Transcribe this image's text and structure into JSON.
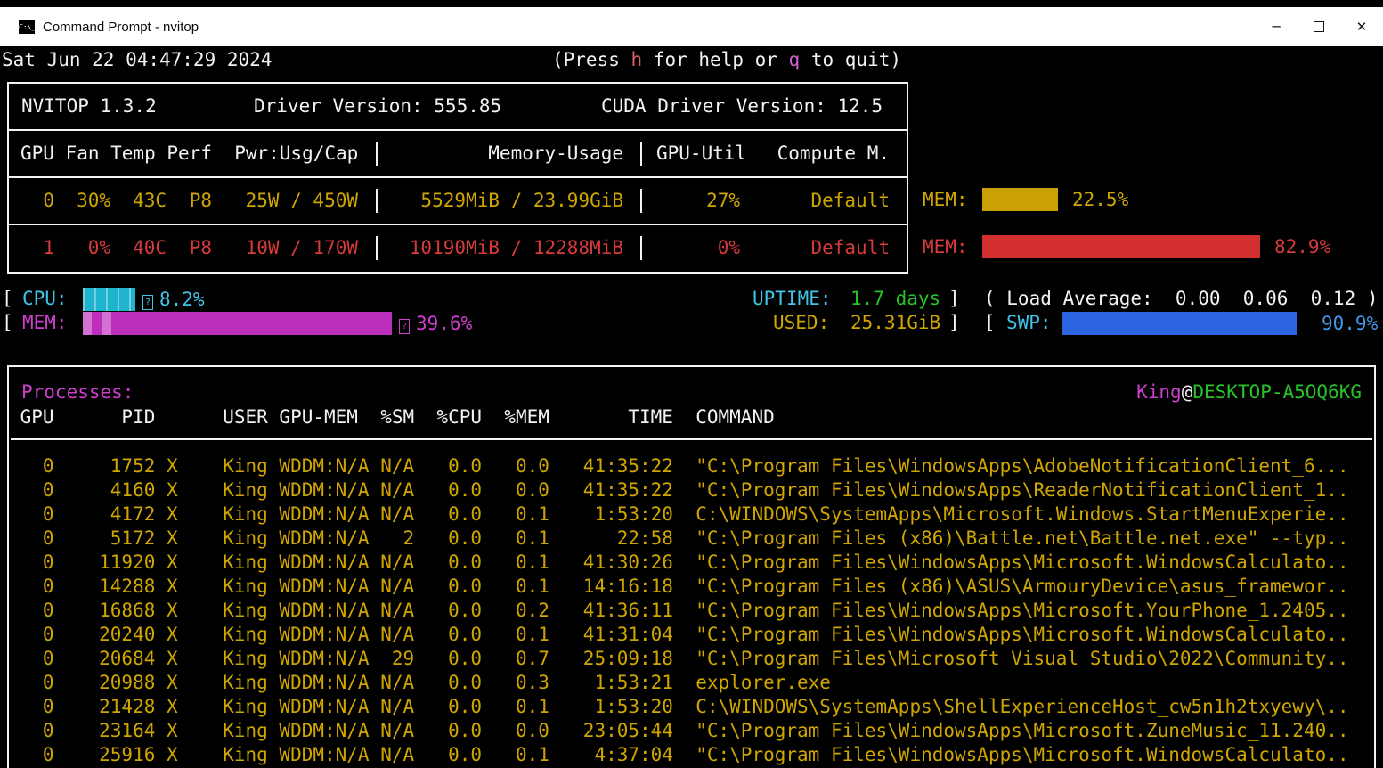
{
  "window": {
    "title": "Command Prompt - nvitop",
    "icon_text": "C:\\_",
    "minimize_glyph": "─",
    "close_glyph": "✕"
  },
  "glyphs": {
    "bracket_open": "[",
    "bracket_close": "]",
    "tofu": "?"
  },
  "statusline": {
    "datetime": "Sat Jun 22 04:47:29 2024",
    "help_prefix": "(Press ",
    "key_help": "h",
    "help_mid": " for help or ",
    "key_quit": "q",
    "help_suffix": " to quit)"
  },
  "gpu_panel": {
    "app_version": "NVITOP 1.3.2",
    "driver_version": "Driver Version: 555.85",
    "cuda_version": "CUDA Driver Version: 12.5",
    "col_headers": {
      "gpu_stats": "GPU Fan Temp Perf  Pwr:Usg/Cap",
      "memory": "Memory-Usage",
      "util": "GPU-Util",
      "compute": "Compute M."
    },
    "gpus": [
      {
        "id": "0",
        "fan": "30%",
        "temp": "43C",
        "perf": "P8",
        "power": "25W / 450W",
        "memory": "5529MiB / 23.99GiB",
        "util": "27%",
        "compute_mode": "Default",
        "mem_gauge_label": "MEM:",
        "mem_pct": 22.5,
        "mem_pct_text": "22.5%"
      },
      {
        "id": "1",
        "fan": "0%",
        "temp": "40C",
        "perf": "P8",
        "power": "10W / 170W",
        "memory": "10190MiB / 12288MiB",
        "util": "0%",
        "compute_mode": "Default",
        "mem_gauge_label": "MEM:",
        "mem_pct": 82.9,
        "mem_pct_text": "82.9%"
      }
    ]
  },
  "system": {
    "cpu": {
      "label": "CPU:",
      "pct": 8.2,
      "pct_text": "8.2%"
    },
    "uptime": {
      "label": "UPTIME:",
      "value": "1.7 days"
    },
    "load": {
      "prefix": "( Load Average:",
      "values": [
        "0.00",
        "0.06",
        "0.12"
      ],
      "suffix": ")"
    },
    "mem": {
      "label": "MEM:",
      "pct": 39.6,
      "pct_text": "39.6%"
    },
    "used": {
      "label": "USED:",
      "value": "25.31GiB"
    },
    "swap": {
      "label": "SWP:",
      "pct": 90.9,
      "pct_text": "90.9%"
    }
  },
  "processes": {
    "title": "Processes:",
    "user": "King",
    "separator": "@",
    "host": "DESKTOP-A5OQ6KG",
    "columns": {
      "gpu": "GPU",
      "pid": "PID",
      "type": " ",
      "user": "USER",
      "gpu_mem": "GPU-MEM",
      "sm": "%SM",
      "cpu": "%CPU",
      "mem": "%MEM",
      "time": "TIME",
      "command": "COMMAND"
    },
    "rows": [
      {
        "gpu": "0",
        "pid": "1752",
        "type": "X",
        "user": "King",
        "gpu_mem": "WDDM:N/A",
        "sm": "N/A",
        "cpu": "0.0",
        "mem": "0.0",
        "time": "41:35:22",
        "command": "\"C:\\Program Files\\WindowsApps\\AdobeNotificationClient_6..."
      },
      {
        "gpu": "0",
        "pid": "4160",
        "type": "X",
        "user": "King",
        "gpu_mem": "WDDM:N/A",
        "sm": "N/A",
        "cpu": "0.0",
        "mem": "0.0",
        "time": "41:35:22",
        "command": "\"C:\\Program Files\\WindowsApps\\ReaderNotificationClient_1.."
      },
      {
        "gpu": "0",
        "pid": "4172",
        "type": "X",
        "user": "King",
        "gpu_mem": "WDDM:N/A",
        "sm": "N/A",
        "cpu": "0.0",
        "mem": "0.1",
        "time": "1:53:20",
        "command": "C:\\WINDOWS\\SystemApps\\Microsoft.Windows.StartMenuExperie.."
      },
      {
        "gpu": "0",
        "pid": "5172",
        "type": "X",
        "user": "King",
        "gpu_mem": "WDDM:N/A",
        "sm": "2",
        "cpu": "0.0",
        "mem": "0.1",
        "time": "22:58",
        "command": "\"C:\\Program Files (x86)\\Battle.net\\Battle.net.exe\" --typ.."
      },
      {
        "gpu": "0",
        "pid": "11920",
        "type": "X",
        "user": "King",
        "gpu_mem": "WDDM:N/A",
        "sm": "N/A",
        "cpu": "0.0",
        "mem": "0.1",
        "time": "41:30:26",
        "command": "\"C:\\Program Files\\WindowsApps\\Microsoft.WindowsCalculato.."
      },
      {
        "gpu": "0",
        "pid": "14288",
        "type": "X",
        "user": "King",
        "gpu_mem": "WDDM:N/A",
        "sm": "N/A",
        "cpu": "0.0",
        "mem": "0.1",
        "time": "14:16:18",
        "command": "\"C:\\Program Files (x86)\\ASUS\\ArmouryDevice\\asus_framewor.."
      },
      {
        "gpu": "0",
        "pid": "16868",
        "type": "X",
        "user": "King",
        "gpu_mem": "WDDM:N/A",
        "sm": "N/A",
        "cpu": "0.0",
        "mem": "0.2",
        "time": "41:36:11",
        "command": "\"C:\\Program Files\\WindowsApps\\Microsoft.YourPhone_1.2405.."
      },
      {
        "gpu": "0",
        "pid": "20240",
        "type": "X",
        "user": "King",
        "gpu_mem": "WDDM:N/A",
        "sm": "N/A",
        "cpu": "0.0",
        "mem": "0.1",
        "time": "41:31:04",
        "command": "\"C:\\Program Files\\WindowsApps\\Microsoft.WindowsCalculato.."
      },
      {
        "gpu": "0",
        "pid": "20684",
        "type": "X",
        "user": "King",
        "gpu_mem": "WDDM:N/A",
        "sm": "29",
        "cpu": "0.0",
        "mem": "0.7",
        "time": "25:09:18",
        "command": "\"C:\\Program Files\\Microsoft Visual Studio\\2022\\Community.."
      },
      {
        "gpu": "0",
        "pid": "20988",
        "type": "X",
        "user": "King",
        "gpu_mem": "WDDM:N/A",
        "sm": "N/A",
        "cpu": "0.0",
        "mem": "0.3",
        "time": "1:53:21",
        "command": "explorer.exe"
      },
      {
        "gpu": "0",
        "pid": "21428",
        "type": "X",
        "user": "King",
        "gpu_mem": "WDDM:N/A",
        "sm": "N/A",
        "cpu": "0.0",
        "mem": "0.1",
        "time": "1:53:20",
        "command": "C:\\WINDOWS\\SystemApps\\ShellExperienceHost_cw5n1h2txyewy\\.."
      },
      {
        "gpu": "0",
        "pid": "23164",
        "type": "X",
        "user": "King",
        "gpu_mem": "WDDM:N/A",
        "sm": "N/A",
        "cpu": "0.0",
        "mem": "0.0",
        "time": "23:05:44",
        "command": "\"C:\\Program Files\\WindowsApps\\Microsoft.ZuneMusic_11.240.."
      },
      {
        "gpu": "0",
        "pid": "25916",
        "type": "X",
        "user": "King",
        "gpu_mem": "WDDM:N/A",
        "sm": "N/A",
        "cpu": "0.0",
        "mem": "0.1",
        "time": "4:37:04",
        "command": "\"C:\\Program Files\\WindowsApps\\Microsoft.WindowsCalculato.."
      }
    ]
  }
}
